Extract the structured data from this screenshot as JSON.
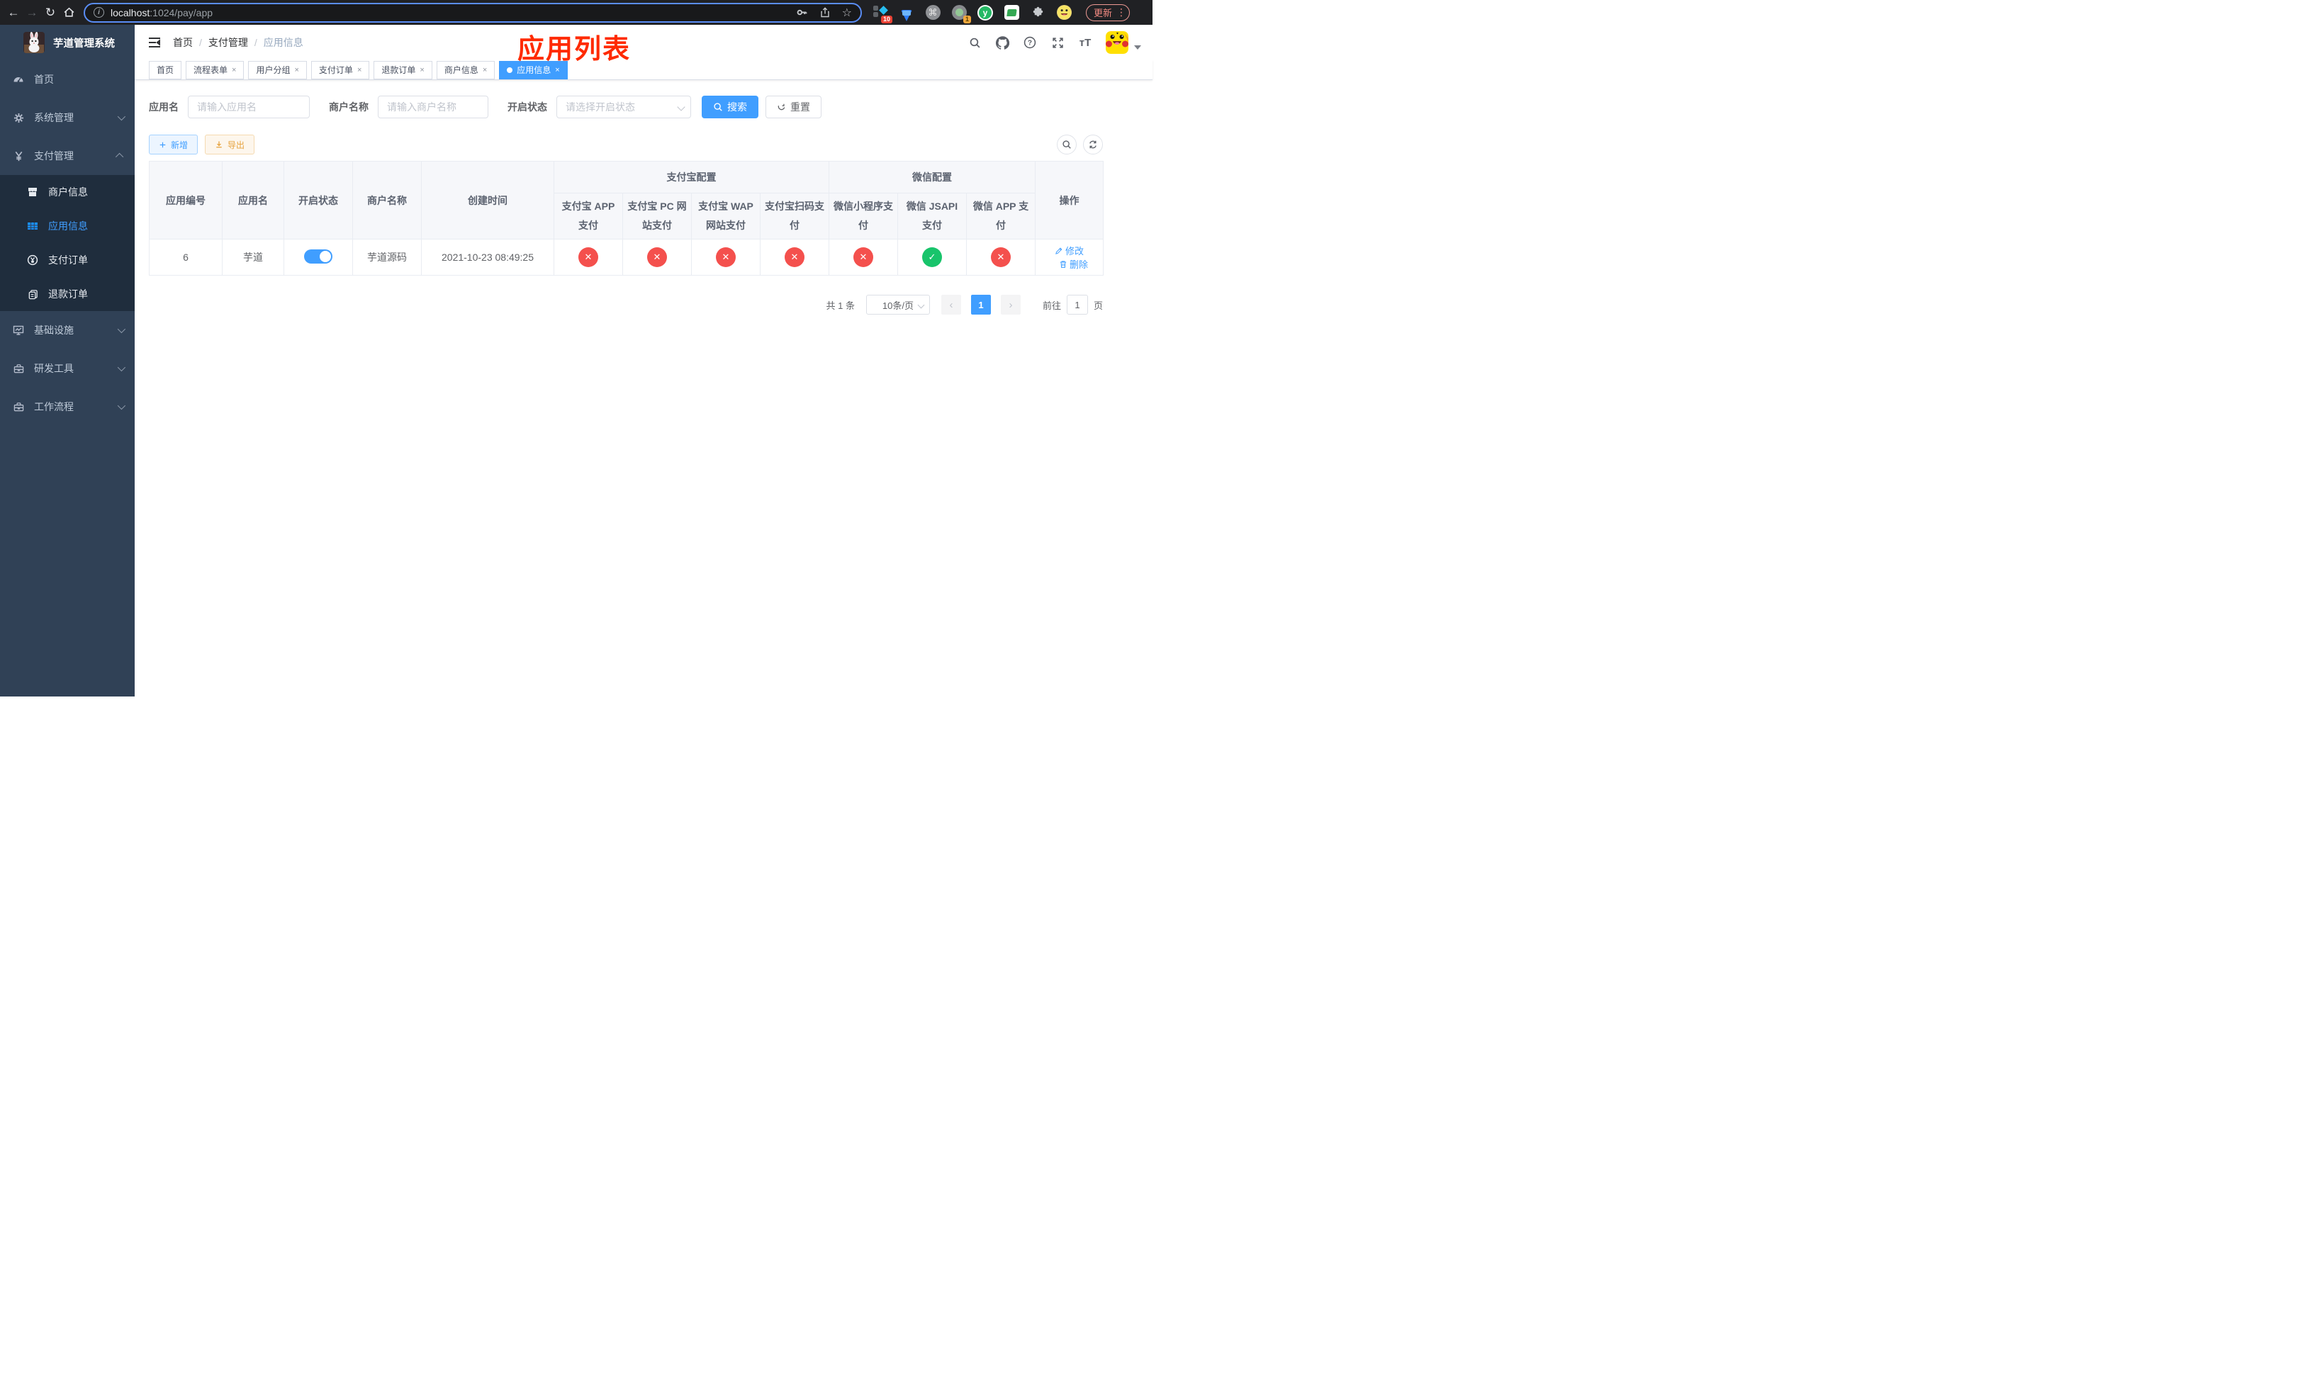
{
  "colors": {
    "primary": "#409eff",
    "success": "#18c46b",
    "danger": "#f4504d",
    "title_red": "#ff2a00"
  },
  "browser": {
    "url_host": "localhost",
    "url_path": ":1024/pay/app",
    "update_label": "更新",
    "kebab": "⋮",
    "ext_badge_kit": "10",
    "ext_badge_one": "1",
    "yuque_letter": "y",
    "cmd_glyph": "⌘",
    "star_glyph": "☆",
    "back_glyph": "←",
    "forward_glyph": "→",
    "reload_glyph": "↻",
    "info_glyph": "i",
    "prev_glyph": "‹",
    "next_glyph": "›"
  },
  "sidebar": {
    "title": "芋道管理系统",
    "items": [
      {
        "label": "首页"
      },
      {
        "label": "系统管理"
      },
      {
        "label": "支付管理"
      },
      {
        "label": "商户信息"
      },
      {
        "label": "应用信息"
      },
      {
        "label": "支付订单"
      },
      {
        "label": "退款订单"
      },
      {
        "label": "基础设施"
      },
      {
        "label": "研发工具"
      },
      {
        "label": "工作流程"
      }
    ]
  },
  "header": {
    "breadcrumb": [
      "首页",
      "支付管理",
      "应用信息"
    ],
    "separator": "/",
    "overlay_title": "应用列表",
    "font_size_icon": "тT"
  },
  "tags": [
    {
      "label": "首页"
    },
    {
      "label": "流程表单"
    },
    {
      "label": "用户分组"
    },
    {
      "label": "支付订单"
    },
    {
      "label": "退款订单"
    },
    {
      "label": "商户信息"
    },
    {
      "label": "应用信息"
    }
  ],
  "close_glyph": "×",
  "filters": {
    "app_name_label": "应用名",
    "app_name_placeholder": "请输入应用名",
    "merchant_label": "商户名称",
    "merchant_placeholder": "请输入商户名称",
    "status_label": "开启状态",
    "status_placeholder": "请选择开启状态",
    "search_label": "搜索",
    "reset_label": "重置"
  },
  "toolbar": {
    "add_label": "新增",
    "export_label": "导出"
  },
  "table": {
    "col_id": "应用编号",
    "col_name": "应用名",
    "col_status": "开启状态",
    "col_merchant": "商户名称",
    "col_created": "创建时间",
    "group_alipay": "支付宝配置",
    "group_wechat": "微信配置",
    "sub": [
      "支付宝 APP 支付",
      "支付宝 PC 网站支付",
      "支付宝 WAP 网站支付",
      "支付宝扫码支付",
      "微信小程序支付",
      "微信 JSAPI 支付",
      "微信 APP 支付"
    ],
    "col_op": "操作",
    "row": {
      "id": "6",
      "name": "芋道",
      "enabled": "on",
      "merchant": "芋道源码",
      "created": "2021-10-23 08:49:25",
      "statuses": [
        "fail",
        "fail",
        "fail",
        "fail",
        "fail",
        "success",
        "fail"
      ],
      "edit_label": "修改",
      "delete_label": "删除"
    }
  },
  "pagination": {
    "total": "共 1 条",
    "page_size": "10条/页",
    "current": "1",
    "goto_label": "前往",
    "goto_value": "1",
    "page_label": "页"
  }
}
